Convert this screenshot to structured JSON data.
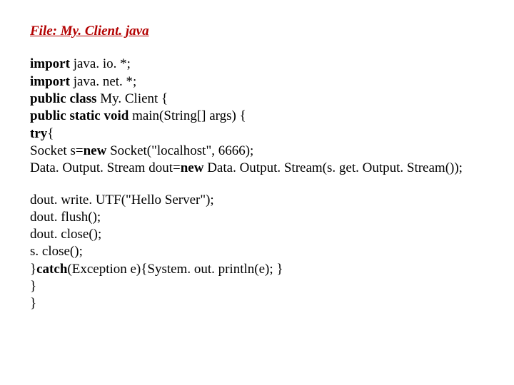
{
  "title": "File: My. Client. java",
  "block1": {
    "l1a": "import ",
    "l1b": "java. io. *;",
    "l2a": "import ",
    "l2b": "java. net. *;",
    "l3a": "public class ",
    "l3b": "My. Client {",
    "l4a": "public static void ",
    "l4b": "main(String[] args) {",
    "l5a": "try",
    "l5b": "{",
    "l6a": "Socket s=",
    "l6b": "new ",
    "l6c": "Socket(\"localhost\", 6666);",
    "l7a": "Data. Output. Stream dout=",
    "l7b": "new ",
    "l7c": "Data. Output. Stream(s. get. Output. Stream());"
  },
  "block2": {
    "l1": "dout. write. UTF(\"Hello Server\");",
    "l2": "dout. flush();",
    "l3": "dout. close();",
    "l4": "s. close();",
    "l5a": "}",
    "l5b": "catch",
    "l5c": "(Exception e){System. out. println(e); }",
    "l6": "}",
    "l7": "}"
  }
}
